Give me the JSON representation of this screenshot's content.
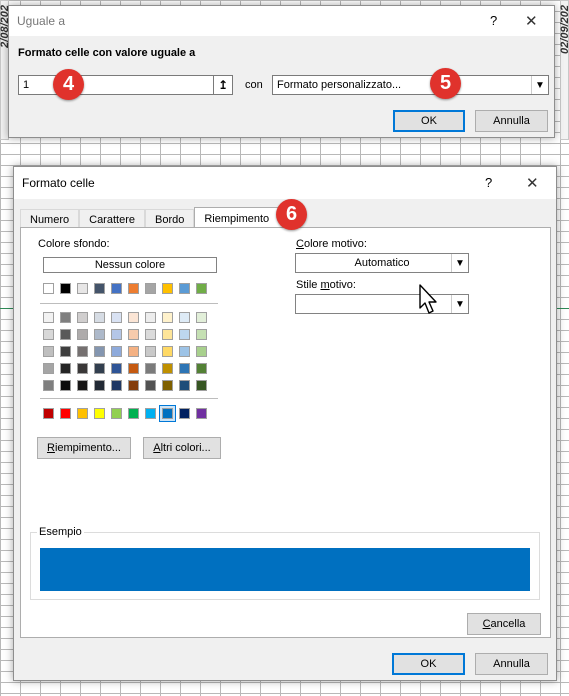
{
  "background": {
    "left_strip_text": "2/08/202",
    "right_strip_text": "02/09/202"
  },
  "dialog1": {
    "title": "Uguale a",
    "help": "?",
    "close": "✕",
    "heading": "Formato celle con valore uguale a",
    "value_input": "1",
    "ref_icon": "↥",
    "con_label": "con",
    "format_select": "Formato personalizzato...",
    "ok": "OK",
    "cancel": "Annulla"
  },
  "dialog2": {
    "title": "Formato celle",
    "help": "?",
    "close": "✕",
    "tabs": [
      "Numero",
      "Carattere",
      "Bordo",
      "Riempimento"
    ],
    "active_tab": "Riempimento",
    "background_color_label": "Colore sfondo:",
    "no_color": "Nessun colore",
    "standard_row": [
      "#ffffff",
      "#000000",
      "#e7e6e6",
      "#44546a",
      "#4472c4",
      "#ed7d31",
      "#a5a5a5",
      "#ffc000",
      "#5b9bd5",
      "#70ad47"
    ],
    "theme_rows": [
      [
        "#f2f2f2",
        "#7f7f7f",
        "#d0cece",
        "#d6dce4",
        "#d9e2f3",
        "#fbe5d5",
        "#ededed",
        "#fff2cc",
        "#deebf6",
        "#e2efd9"
      ],
      [
        "#d8d8d8",
        "#595959",
        "#aeabab",
        "#adb9ca",
        "#b4c6e7",
        "#f7cbac",
        "#dbdbdb",
        "#fee599",
        "#bdd7ee",
        "#c5e0b3"
      ],
      [
        "#bfbfbf",
        "#3f3f3f",
        "#757070",
        "#8496b0",
        "#8eaadb",
        "#f4b183",
        "#c9c9c9",
        "#ffd965",
        "#9dc3e6",
        "#a8d08d"
      ],
      [
        "#a5a5a5",
        "#262626",
        "#3a3838",
        "#323f4f",
        "#2f5496",
        "#c55a11",
        "#7b7b7b",
        "#bf9000",
        "#2e75b5",
        "#538135"
      ],
      [
        "#7f7f7f",
        "#0c0c0c",
        "#171616",
        "#222a35",
        "#1f3864",
        "#833c0b",
        "#525252",
        "#7f6000",
        "#1e4e79",
        "#375623"
      ]
    ],
    "bright_row": [
      "#c00000",
      "#ff0000",
      "#ffc000",
      "#ffff00",
      "#92d050",
      "#00b050",
      "#00b0f0",
      "#0070c0",
      "#002060",
      "#7030a0"
    ],
    "selected_bright_index": 7,
    "fill_effects_button": {
      "pre": "",
      "key": "R",
      "post": "iempimento..."
    },
    "more_colors_button": {
      "pre": "",
      "key": "A",
      "post": "ltri colori..."
    },
    "pattern_color_label": {
      "pre": "",
      "key": "C",
      "post": "olore motivo:"
    },
    "pattern_color_value": "Automatico",
    "pattern_style_label": {
      "pre": "Stile ",
      "key": "m",
      "post": "otivo:"
    },
    "pattern_style_value": "",
    "sample_label": "Esempio",
    "sample_color": "#0070c0",
    "clear_button": {
      "pre": "",
      "key": "C",
      "post": "ancella"
    },
    "ok": "OK",
    "cancel": "Annulla"
  },
  "badges": [
    "4",
    "5",
    "6"
  ],
  "colors": {
    "accent": "#0078d7",
    "badge": "#e0322c"
  }
}
